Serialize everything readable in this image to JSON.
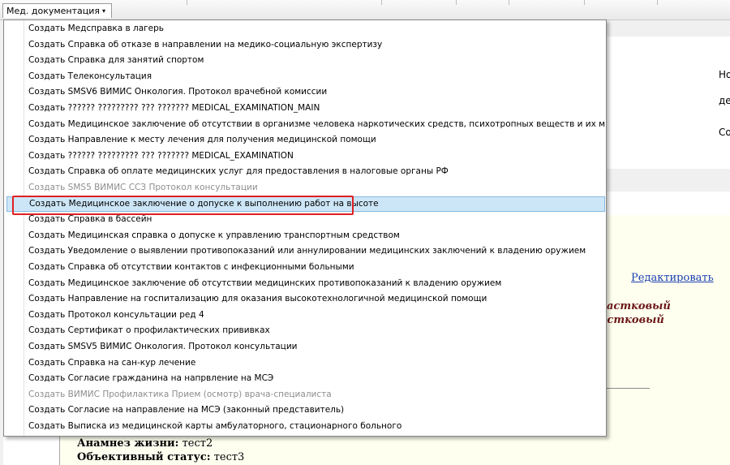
{
  "toolbar": {
    "menu_label": "Мед. документация",
    "arrow": "▾"
  },
  "right_panel": {
    "line1": "Но",
    "line2": "де",
    "line3": "Со"
  },
  "form": {
    "edit_link": "Редактировать",
    "fragment1": "астковый",
    "fragment2": "астковый",
    "anamnesis_label": "Анамнез жизни:",
    "anamnesis_value": " тест2",
    "status_label": "Объективный статус:",
    "status_value": " тест3"
  },
  "menu": {
    "items": [
      {
        "label": "Создать Медсправка в лагерь",
        "disabled": false
      },
      {
        "label": "Создать Справка об отказе в направлении на медико-социальную экспертизу",
        "disabled": false
      },
      {
        "label": "Создать Справка для занятий спортом",
        "disabled": false
      },
      {
        "label": "Создать Телеконсультация",
        "disabled": false
      },
      {
        "label": "Создать SMSV6 ВИМИС Онкология. Протокол врачебной комиссии",
        "disabled": false
      },
      {
        "label": "Создать ?????? ????????? ??? ??????? MEDICAL_EXAMINATION_MAIN",
        "disabled": false
      },
      {
        "label": "Создать Медицинское заключение об отсутствии в организме человека наркотических средств, психотропных веществ и их метаболитов",
        "disabled": false
      },
      {
        "label": "Создать Направление к месту лечения для получения медицинской помощи",
        "disabled": false
      },
      {
        "label": "Создать ?????? ????????? ??? ??????? MEDICAL_EXAMINATION",
        "disabled": false
      },
      {
        "label": "Создать Справка об оплате медицинских услуг для предоставления в налоговые органы РФ",
        "disabled": false
      },
      {
        "label": "Создать SMS5 ВИМИС ССЗ Протокол консультации",
        "disabled": true
      },
      {
        "label": "Создать Медицинское заключение о допуске к выполнению работ на высоте",
        "disabled": false,
        "selected": true
      },
      {
        "label": "Создать Справка в бассейн",
        "disabled": false
      },
      {
        "label": "Создать Медицинская справка о допуске к управлению транспортным средством",
        "disabled": false
      },
      {
        "label": "Создать Уведомление о выявлении противопоказаний или аннулировании медицинских заключений к владению оружием",
        "disabled": false
      },
      {
        "label": "Создать Справка об отсутствии контактов с инфекционными больными",
        "disabled": false
      },
      {
        "label": "Создать Медицинское заключение об отсутствии медицинских противопоказаний к владению оружием",
        "disabled": false
      },
      {
        "label": "Создать Направление на госпитализацию для оказания высокотехнологичной медицинской помощи",
        "disabled": false
      },
      {
        "label": "Создать Протокол консультации ред 4",
        "disabled": false
      },
      {
        "label": "Создать Сертификат о профилактических прививках",
        "disabled": false
      },
      {
        "label": "Создать SMSV5 ВИМИС Онкология. Протокол консультации",
        "disabled": false
      },
      {
        "label": "Создать Справка на сан-кур лечение",
        "disabled": false
      },
      {
        "label": "Создать Согласие гражданина на напрвление на МСЭ",
        "disabled": false
      },
      {
        "label": "Создать ВИМИС Профилактика Прием (осмотр) врача-специалиста",
        "disabled": true
      },
      {
        "label": "Создать Согласие на направление на МСЭ (законный представитель)",
        "disabled": false
      },
      {
        "label": "Создать Выписка из медицинской карты амбулаторного, стационарного больного",
        "disabled": false
      }
    ]
  },
  "colors": {
    "selected_bg": "#cde6f7",
    "selected_border": "#85b8e0",
    "highlight": "#e02020",
    "disabled_text": "#8d8d8d",
    "form_bg": "#fffff0"
  }
}
